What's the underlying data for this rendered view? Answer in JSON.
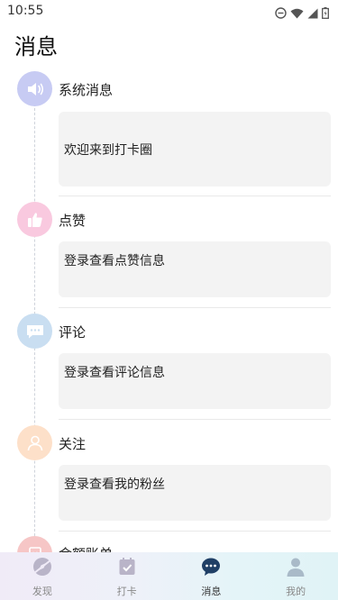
{
  "status_bar": {
    "time": "10:55"
  },
  "page": {
    "title": "消息"
  },
  "entries": [
    {
      "title": "系统消息",
      "card_text": "欢迎来到打卡圈",
      "icon": "speaker-icon",
      "color": "#c7cbf3"
    },
    {
      "title": "点赞",
      "card_text": "登录查看点赞信息",
      "icon": "thumbs-up-icon",
      "color": "#f9c9df"
    },
    {
      "title": "评论",
      "card_text": "登录查看评论信息",
      "icon": "comment-icon",
      "color": "#c9def1"
    },
    {
      "title": "关注",
      "card_text": "登录查看我的粉丝",
      "icon": "person-icon",
      "color": "#fde0c9"
    },
    {
      "title": "金额账单",
      "icon": "bill-icon",
      "color": "#f6c6c6"
    }
  ],
  "nav": [
    {
      "label": "发现",
      "icon": "discover-icon",
      "active": false
    },
    {
      "label": "打卡",
      "icon": "checkin-icon",
      "active": false
    },
    {
      "label": "消息",
      "icon": "message-icon",
      "active": true
    },
    {
      "label": "我的",
      "icon": "profile-icon",
      "active": false
    }
  ]
}
